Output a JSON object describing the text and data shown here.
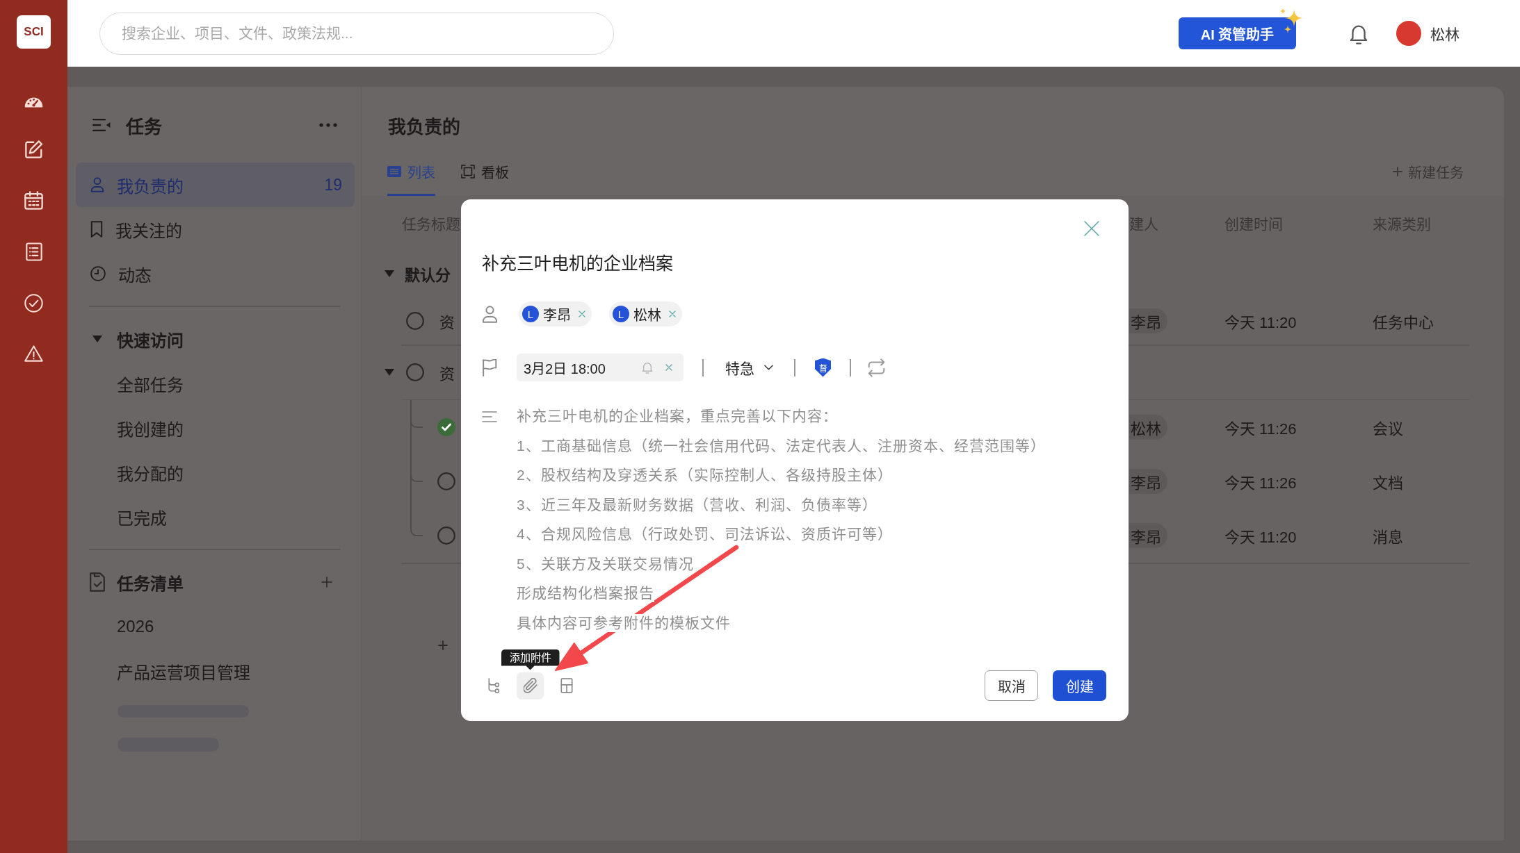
{
  "rail": {
    "logo": "SCI",
    "items": [
      {
        "kind": "dashboard"
      },
      {
        "kind": "edit"
      },
      {
        "kind": "calendar"
      },
      {
        "kind": "list"
      },
      {
        "kind": "check"
      },
      {
        "kind": "alert"
      }
    ]
  },
  "topbar": {
    "search": {
      "placeholder": "搜索企业、项目、文件、政策法规..."
    },
    "ai_button": "AI 资管助手",
    "user": {
      "name": "松林"
    }
  },
  "sidebar": {
    "title": "任务",
    "items": [
      {
        "kind": "person",
        "label": "我负责的",
        "count": "19",
        "selected": true
      },
      {
        "kind": "bookmark",
        "label": "我关注的",
        "selected": false
      },
      {
        "kind": "clock",
        "label": "动态",
        "selected": false
      }
    ],
    "sections": [
      {
        "kind": "group",
        "title": "快速访问",
        "expanded": true,
        "items": [
          {
            "label": "全部任务",
            "selected": false
          },
          {
            "label": "我创建的",
            "selected": false
          },
          {
            "label": "我分配的",
            "selected": false
          },
          {
            "label": "已完成",
            "selected": false
          }
        ]
      },
      {
        "kind": "lists",
        "title": "任务清单",
        "loading": true,
        "items": [
          {
            "label": "2026",
            "selected": false
          },
          {
            "label": "产品运营项目管理",
            "selected": false
          }
        ]
      }
    ]
  },
  "main": {
    "title": "我负责的",
    "tabs": [
      {
        "kind": "list",
        "label": "列表",
        "selected": true
      },
      {
        "kind": "board",
        "label": "看板",
        "selected": false
      }
    ],
    "new_task": "新建任务",
    "table": {
      "columns": [
        {
          "label": "任务标题"
        },
        {
          "label": "建人"
        },
        {
          "label": "创建时间"
        },
        {
          "label": "来源类别"
        }
      ],
      "rows": [
        {
          "kind": "group",
          "title": "默认分",
          "expanded": true,
          "children": [
            {
              "kind": "task",
              "title": "资",
              "checked": false,
              "creator": "李昂",
              "created": "今天 11:20",
              "source": "任务中心"
            }
          ]
        },
        {
          "kind": "task",
          "title": "资",
          "checked": false,
          "expanded": true,
          "children": [
            {
              "kind": "task",
              "checked": true,
              "creator": "松林",
              "created": "今天 11:26",
              "source": "会议"
            },
            {
              "kind": "task",
              "checked": false,
              "creator": "李昂",
              "created": "今天 11:26",
              "source": "文档"
            },
            {
              "kind": "task",
              "checked": false,
              "creator": "李昂",
              "created": "今天 11:20",
              "source": "消息"
            }
          ]
        }
      ]
    }
  },
  "dialog": {
    "title": "补充三叶电机的企业档案",
    "assignees": [
      {
        "initial": "L",
        "name": "李昂"
      },
      {
        "initial": "L",
        "name": "松林"
      }
    ],
    "due": "3月2日 18:00",
    "priority": "特急",
    "badge": "督",
    "description": [
      "补充三叶电机的企业档案，重点完善以下内容：",
      "1、工商基础信息（统一社会信用代码、法定代表人、注册资本、经营范围等）",
      "2、股权结构及穿透关系（实际控制人、各级持股主体）",
      "3、近三年及最新财务数据（营收、利润、负债率等）",
      "4、合规风险信息（行政处罚、司法诉讼、资质许可等）",
      "5、关联方及关联交易情况",
      "形成结构化档案报告",
      "具体内容可参考附件的模板文件"
    ],
    "tools": [
      {
        "kind": "subtask",
        "hovered": false
      },
      {
        "kind": "attach",
        "hovered": true,
        "tooltip": "添加附件"
      },
      {
        "kind": "layout",
        "hovered": false
      }
    ],
    "buttons": [
      {
        "kind": "secondary",
        "label": "取消"
      },
      {
        "kind": "primary",
        "label": "创建"
      }
    ]
  }
}
